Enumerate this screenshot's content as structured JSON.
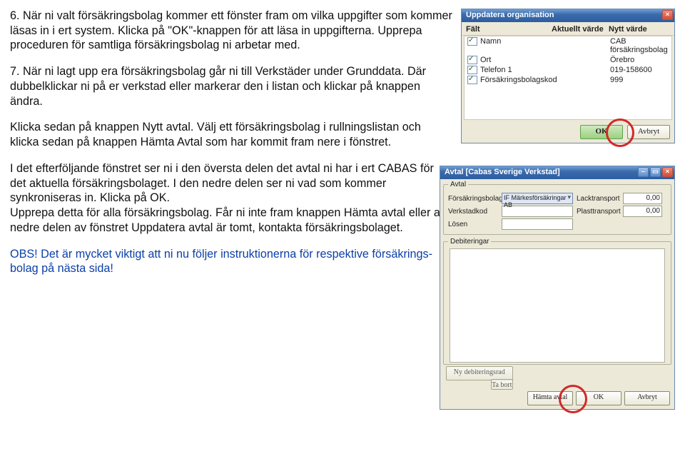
{
  "instructions": {
    "p1": "6. När ni valt försäkringsbolag kommer ett fönster fram om vilka uppgifter som kommer läsas in i ert system. Klicka på \"OK\"-knappen för att läsa in uppgifterna. Upprepa proceduren för samtliga försäkringsbolag ni arbetar med.",
    "p2": "7. När ni lagt upp era försäkringsbolag går ni till Verkstäder under Grunddata. Där dubbelklickar ni på er verkstad eller markerar den i listan och klickar på knappen ändra.",
    "p3": "Klicka sedan på knappen Nytt avtal. Välj ett försäkringsbolag i rullningslistan och klicka sedan på knappen Hämta Avtal som har kommit fram nere i fönstret.",
    "p4": "I det efterföljande fönstret ser ni i den översta delen det avtal ni har i ert CABAS för det aktuella försäkringsbolaget. I den nedre delen ser ni vad som kommer synkroniseras in. Klicka på OK.",
    "p5": "Upprepa detta för alla försäkringsbolag. Får ni inte fram knappen Hämta avtal eller att nedre delen av fönstret Uppdatera avtal är tomt, kontakta försäkringsbolaget.",
    "obs": "OBS! Det är mycket viktigt att ni nu följer instruktionerna för respektive försäkrings­bolag på nästa sida!"
  },
  "dlg1": {
    "title": "Uppdatera organisation",
    "headers": {
      "field": "Fält",
      "current": "Aktuellt värde",
      "new": "Nytt värde"
    },
    "rows": [
      {
        "field": "Namn",
        "new": "CAB försäkringsbolag"
      },
      {
        "field": "Ort",
        "new": "Örebro"
      },
      {
        "field": "Telefon 1",
        "new": "019-158600"
      },
      {
        "field": "Försäkringsbolagskod",
        "new": "999"
      }
    ],
    "ok": "OK",
    "cancel": "Avbryt"
  },
  "dlg2": {
    "title": "Avtal [Cabas Sverige Verkstad]",
    "grpAvtal": "Avtal",
    "fields": {
      "forsakringsbolag": "Försäkringsbolag",
      "forsakringsbolag_value": "IF Märkesförsäkringar AB",
      "verkstadkod": "Verkstadkod",
      "losen": "Lösen",
      "lacktransport": "Lacktransport",
      "lacktransport_value": "0,00",
      "plasttransport": "Plasttransport",
      "plasttransport_value": "0,00"
    },
    "grpDebit": "Debiteringar",
    "newDebLine": "Ny debiteringsrad",
    "delete": "Ta bort",
    "hamta": "Hämta avtal",
    "ok": "OK",
    "cancel": "Avbryt"
  }
}
